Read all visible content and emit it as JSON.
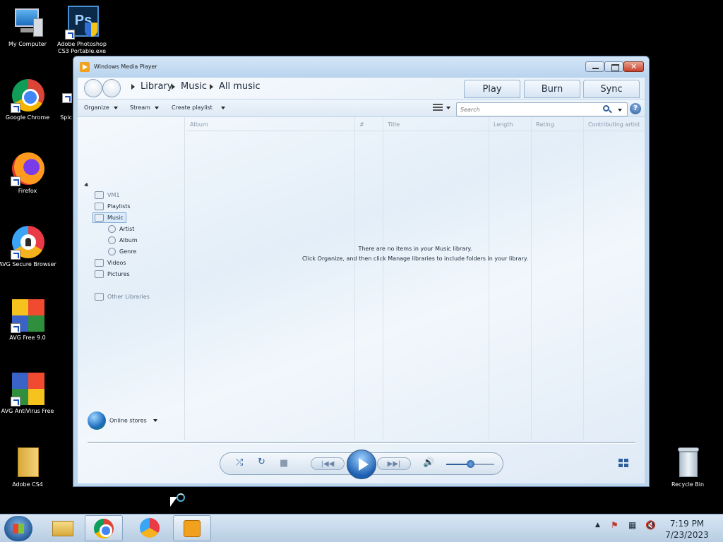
{
  "desktop": {
    "icons": [
      {
        "label": "My Computer"
      },
      {
        "label": "Adobe Photoshop CS3 Portable.exe"
      },
      {
        "label": "Google Chrome"
      },
      {
        "label": "Spic"
      },
      {
        "label": "Firefox"
      },
      {
        "label": "AVG Secure Browser"
      },
      {
        "label": "AVG Free 9.0"
      },
      {
        "label": "AVG AntiVirus Free"
      },
      {
        "label": "Adobe CS4"
      },
      {
        "label": "Recycle Bin"
      }
    ]
  },
  "window": {
    "title": "Windows Media Player",
    "breadcrumb": [
      "Library",
      "Music",
      "All music"
    ],
    "tabs": [
      "Play",
      "Burn",
      "Sync"
    ],
    "toolbar": {
      "organize": "Organize",
      "stream": "Stream",
      "create_playlist": "Create playlist"
    },
    "search": {
      "placeholder": "Search"
    },
    "nav": {
      "vm": "VM1",
      "playlists": "Playlists",
      "music": "Music",
      "artist": "Artist",
      "album": "Album",
      "genre": "Genre",
      "videos": "Videos",
      "pictures": "Pictures",
      "other_libraries": "Other Libraries",
      "online_stores": "Online stores"
    },
    "columns": [
      "Album",
      "#",
      "Title",
      "Length",
      "Rating",
      "Contributing artist"
    ],
    "empty_message": {
      "line1": "There are no items in your Music library.",
      "line2": "Click Organize, and then click Manage libraries to include folders in your library."
    },
    "volume_level": 0.5
  },
  "taskbar": {
    "time": "7:19 PM",
    "date": "7/23/2023"
  },
  "colors": {
    "accent": "#2e5f9a",
    "window_bg": "#e3eef8"
  }
}
